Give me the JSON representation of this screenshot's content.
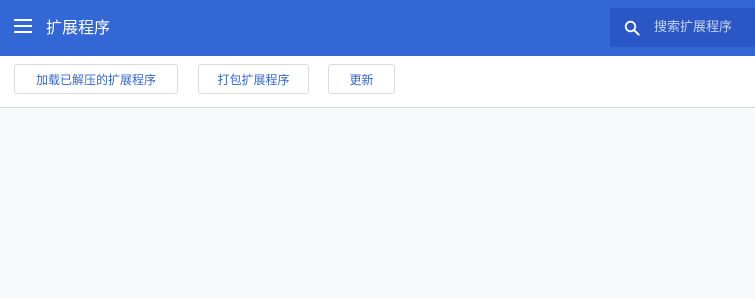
{
  "header": {
    "title": "扩展程序",
    "menu_icon": "hamburger-menu-icon",
    "search": {
      "placeholder": "搜索扩展程序",
      "value": "",
      "icon": "search-icon"
    }
  },
  "toolbar": {
    "load_unpacked_label": "加载已解压的扩展程序",
    "pack_label": "打包扩展程序",
    "update_label": "更新"
  },
  "colors": {
    "header_bg": "#3367d6",
    "search_bg": "#2a56c6",
    "accent_text": "#3367d6",
    "page_bg": "#f8f9fa"
  }
}
